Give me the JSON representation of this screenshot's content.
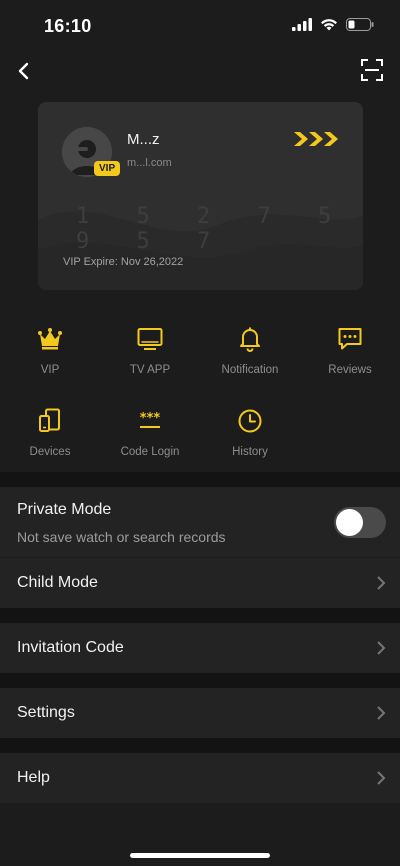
{
  "status": {
    "time": "16:10"
  },
  "card": {
    "username": "M...z",
    "email": "m...l.com",
    "vip_badge": "VIP",
    "card_number": "1 5 2 7 5 9 5 7",
    "expire": "VIP Expire: Nov 26,2022"
  },
  "features": [
    {
      "label": "VIP",
      "icon": "crown-icon"
    },
    {
      "label": "TV APP",
      "icon": "tv-icon"
    },
    {
      "label": "Notification",
      "icon": "bell-icon"
    },
    {
      "label": "Reviews",
      "icon": "chat-icon"
    },
    {
      "label": "Devices",
      "icon": "devices-icon"
    },
    {
      "label": "Code Login",
      "icon": "code-login-icon"
    },
    {
      "label": "History",
      "icon": "clock-icon"
    }
  ],
  "settings": {
    "private_mode": {
      "title": "Private Mode",
      "subtitle": "Not save watch or search records",
      "enabled": false
    },
    "child_mode": "Child Mode",
    "invitation_code": "Invitation Code",
    "settings": "Settings",
    "help": "Help"
  },
  "colors": {
    "accent": "#f4c91d",
    "background": "#1c1c1c",
    "row": "#232323"
  }
}
